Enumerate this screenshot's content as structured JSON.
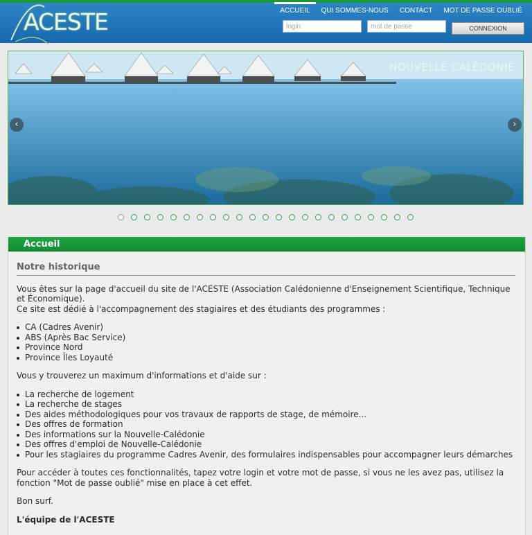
{
  "header": {
    "logo_text": "ACESTE",
    "nav": [
      {
        "label": "ACCUEIL",
        "active": true
      },
      {
        "label": "QUI SOMMES-NOUS",
        "active": false
      },
      {
        "label": "CONTACT",
        "active": false
      },
      {
        "label": "MOT DE PASSE OUBLIÉ",
        "active": false
      }
    ],
    "login_placeholder": "login",
    "password_placeholder": "mot de passe",
    "connect_label": "CONNEXION"
  },
  "slider": {
    "caption": "NOUVELLE CALÉDONIE",
    "prev_glyph": "‹",
    "next_glyph": "›",
    "slide_count": 23,
    "active_slide": 1
  },
  "main": {
    "panel_title": "Accueil",
    "section_title": "Notre historique",
    "intro": "Vous êtes sur la page d'accueil du site de l'ACESTE (Association Calédonienne d'Enseignement Scientifique, Technique et Économique).",
    "intro2": "Ce site est dédié à l'accompagnement des stagiaires et des étudiants des programmes :",
    "programs": [
      "CA (Cadres Avenir)",
      "ABS (Après Bac Service)",
      "Province Nord",
      "Province Îles Loyauté"
    ],
    "info_intro": "Vous y trouverez un maximum d'informations et d'aide sur :",
    "info_items": [
      "La recherche de logement",
      "La recherche de stages",
      "Des aides méthodologiques pour vos travaux de rapports de stage, de mémoire...",
      "Des offres de formation",
      "Des informations sur la Nouvelle-Calédonie",
      "Des offres d'emploi de Nouvelle-Calédonie",
      "Pour les stagiaires du programme Cadres Avenir, des formulaires indispensables pour accompagner leurs démarches"
    ],
    "access_text": "Pour accéder à toutes ces fonctionnalités, tapez votre login et votre mot de passe, si vous ne les avez pas, utilisez la fonction \"Mot de passe oublié\" mise en place à cet effet.",
    "bon_surf": "Bon surf.",
    "signature": "L'équipe de l'ACESTE"
  }
}
